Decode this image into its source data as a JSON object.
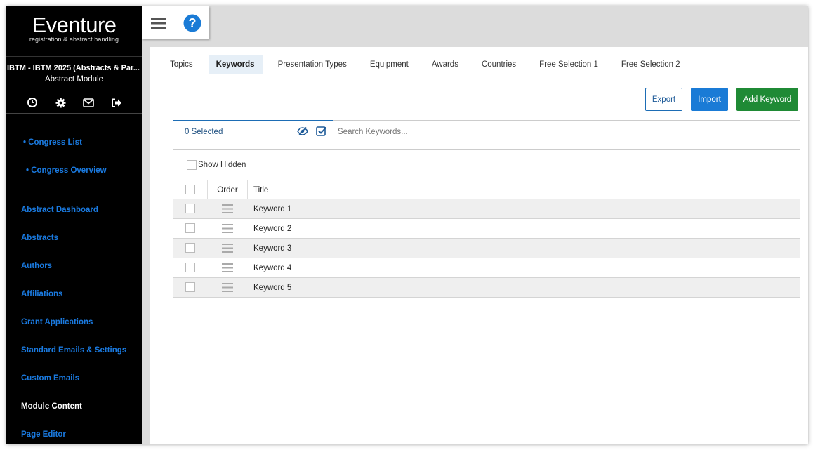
{
  "brand": {
    "name": "Eventure",
    "tagline": "registration & abstract handling"
  },
  "event": {
    "title": "IBTM - IBTM 2025 (Abstracts & Par...",
    "module": "Abstract Module"
  },
  "sidebar_icons": [
    "clock-icon",
    "gear-icon",
    "mail-icon",
    "logout-icon"
  ],
  "sidebar": {
    "sublinks": [
      "• Congress List",
      "• Congress Overview"
    ],
    "items": [
      "Abstract Dashboard",
      "Abstracts",
      "Authors",
      "Affiliations",
      "Grant Applications",
      "Standard Emails & Settings",
      "Custom Emails",
      "Module Content",
      "Page Editor"
    ],
    "active": "Module Content"
  },
  "tabs": [
    "Topics",
    "Keywords",
    "Presentation Types",
    "Equipment",
    "Awards",
    "Countries",
    "Free Selection 1",
    "Free Selection 2"
  ],
  "active_tab": "Keywords",
  "actions": {
    "export": "Export",
    "import": "Import",
    "add": "Add Keyword"
  },
  "selection": {
    "label": "0 Selected"
  },
  "search": {
    "placeholder": "Search Keywords..."
  },
  "table": {
    "show_hidden": "Show Hidden",
    "headers": {
      "order": "Order",
      "title": "Title"
    },
    "rows": [
      "Keyword 1",
      "Keyword 2",
      "Keyword 3",
      "Keyword 4",
      "Keyword 5"
    ]
  },
  "colors": {
    "sidebar_bg": "#000000",
    "link": "#1a7ae0",
    "primary": "#1a7bd6",
    "success": "#1f8a35",
    "help_icon": "#1a7bd6"
  }
}
